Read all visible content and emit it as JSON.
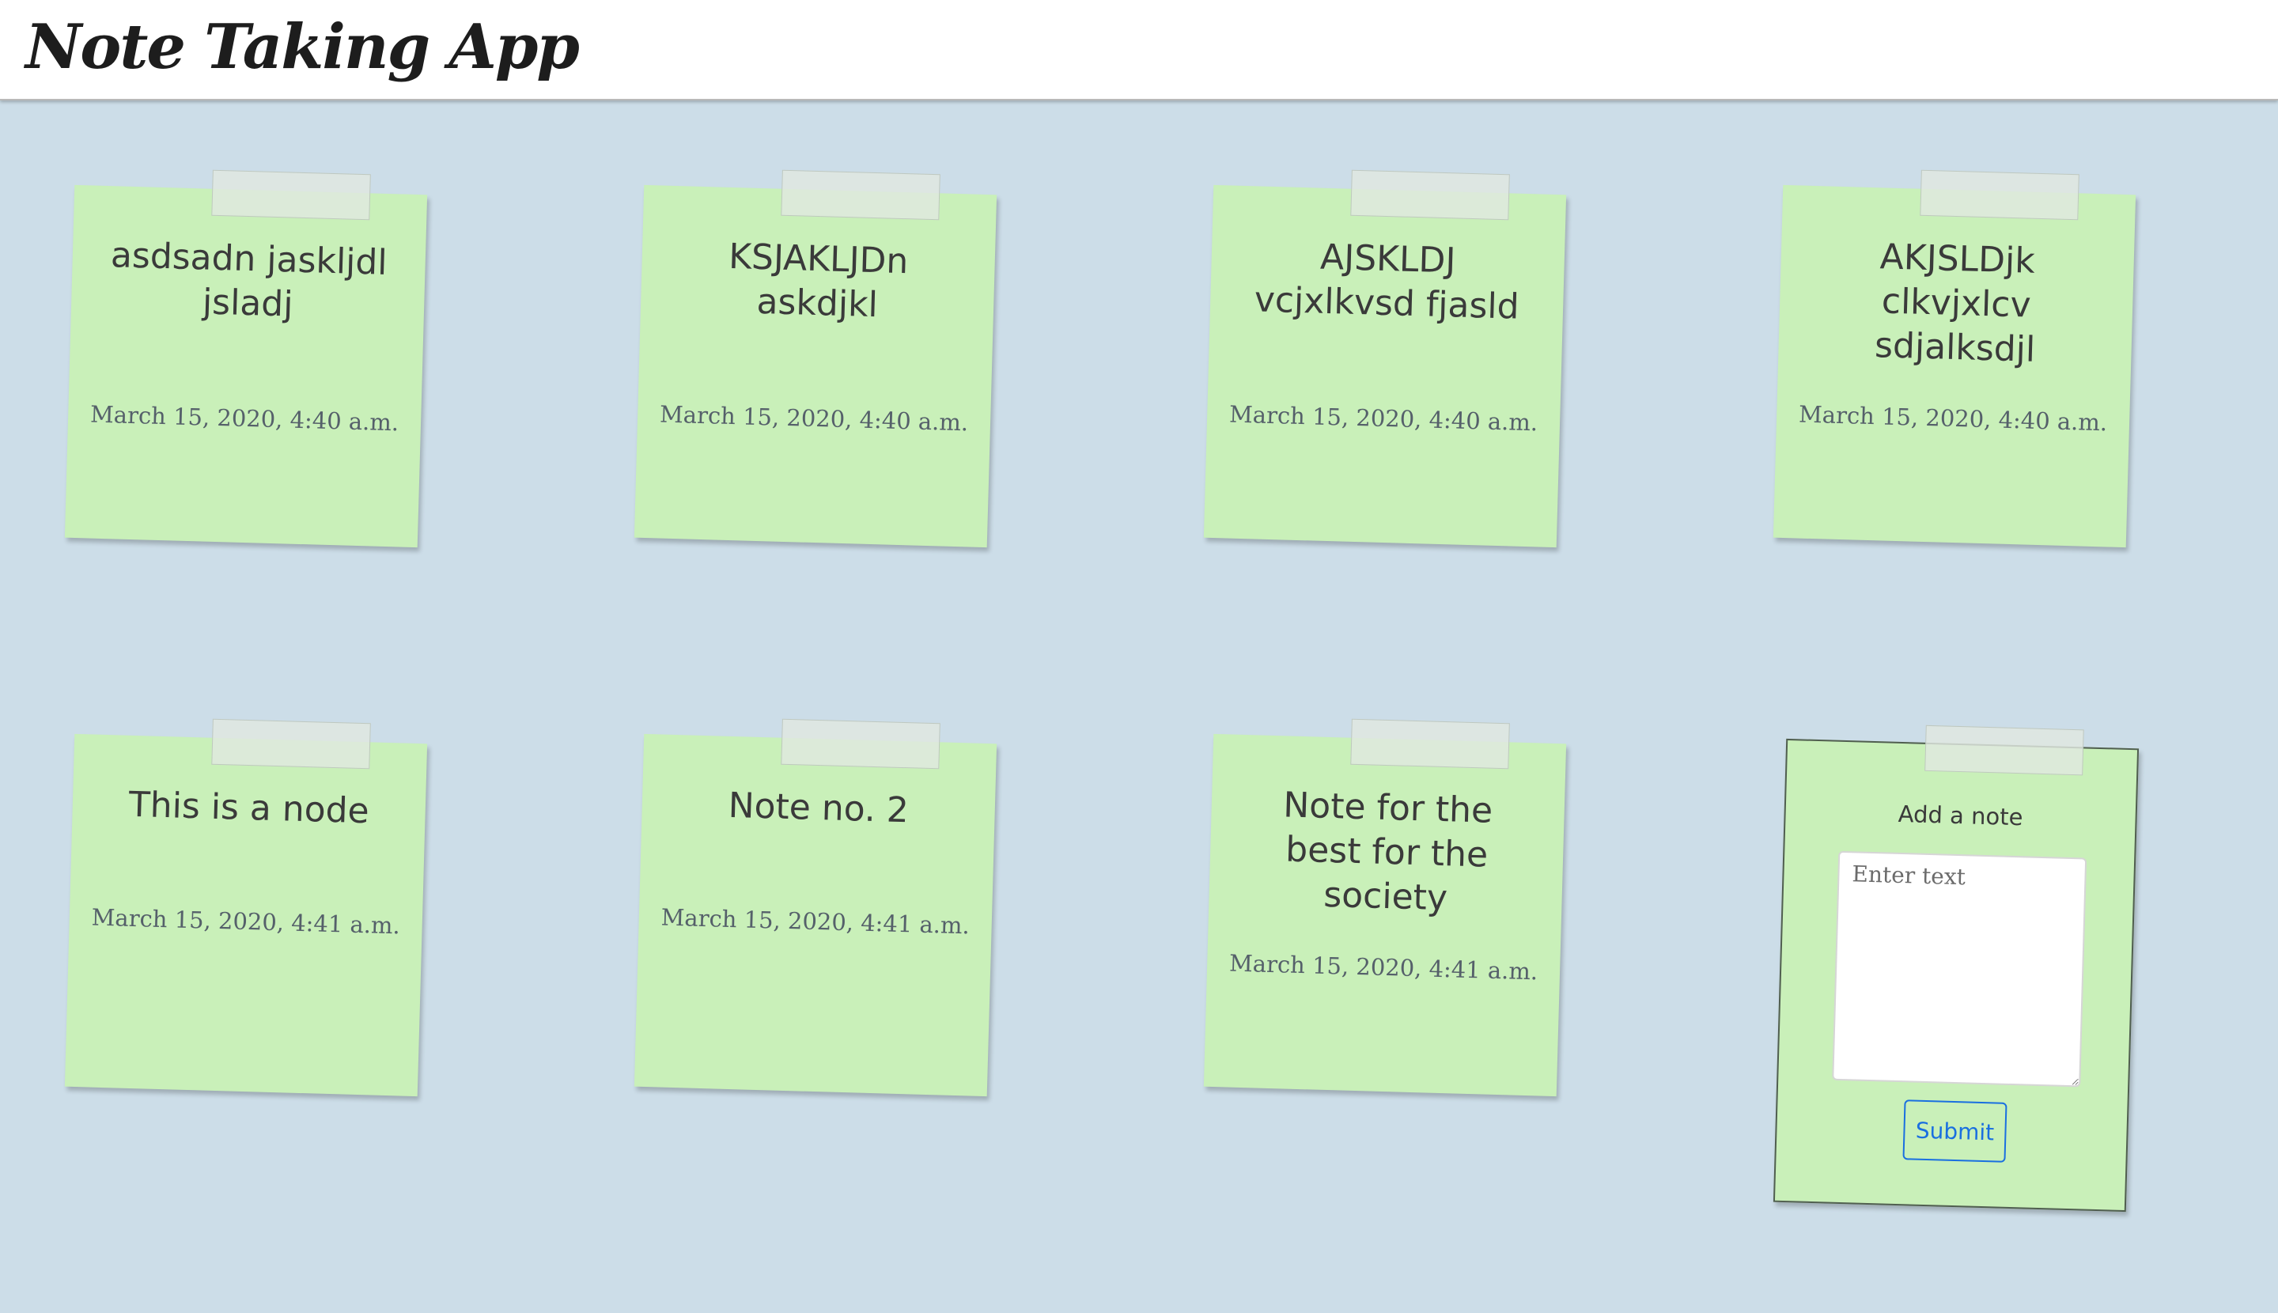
{
  "header": {
    "title": "Note Taking App"
  },
  "notes": [
    {
      "text": "asdsadn jaskljdl jsladj",
      "date": "March 15, 2020, 4:40 a.m."
    },
    {
      "text": "KSJAKLJDn askdjkl",
      "date": "March 15, 2020, 4:40 a.m."
    },
    {
      "text": "AJSKLDJ vcjxlkvsd fjasld",
      "date": "March 15, 2020, 4:40 a.m."
    },
    {
      "text": "AKJSLDjk clkvjxlcv sdjalksdjl",
      "date": "March 15, 2020, 4:40 a.m."
    },
    {
      "text": "This is a node",
      "date": "March 15, 2020, 4:41 a.m."
    },
    {
      "text": "Note no. 2",
      "date": "March 15, 2020, 4:41 a.m."
    },
    {
      "text": "Note for the best for the society",
      "date": "March 15, 2020, 4:41 a.m."
    }
  ],
  "add_note": {
    "title": "Add a note",
    "placeholder": "Enter text",
    "submit_label": "Submit"
  }
}
